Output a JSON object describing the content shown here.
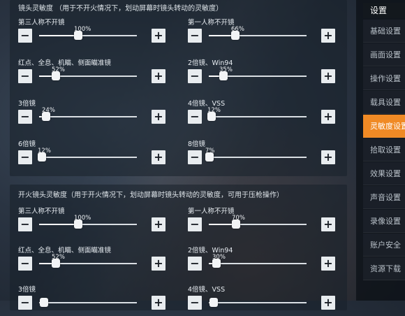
{
  "scope_section": {
    "title": "镜头灵敏度 （用于不开火情况下，划动屏幕时镜头转动的灵敏度）",
    "controls": [
      {
        "label": "第三人称不开镜",
        "value_text": "100%",
        "level": 0.4
      },
      {
        "label": "第一人称不开镜",
        "value_text": "66%",
        "level": 0.27
      },
      {
        "label": "红点、全息、机瞄、侧面瞄准镜",
        "value_text": "52%",
        "level": 0.17
      },
      {
        "label": "2倍镜、Win94",
        "value_text": "35%",
        "level": 0.15
      },
      {
        "label": "3倍镜",
        "value_text": "24%",
        "level": 0.07
      },
      {
        "label": "4倍镜、VSS",
        "value_text": "12%",
        "level": 0.03
      },
      {
        "label": "6倍镜",
        "value_text": "12%",
        "level": 0.03
      },
      {
        "label": "8倍镜",
        "value_text": "7%",
        "level": 0.01
      }
    ]
  },
  "fire_section": {
    "title": "开火镜头灵敏度（用于开火情况下，划动屏幕时镜头转动的灵敏度，可用于压枪操作）",
    "controls": [
      {
        "label": "第三人称不开镜",
        "value_text": "100%",
        "level": 0.4
      },
      {
        "label": "第一人称不开镜",
        "value_text": "70%",
        "level": 0.28
      },
      {
        "label": "红点、全息、机瞄、侧面瞄准镜",
        "value_text": "52%",
        "level": 0.17
      },
      {
        "label": "2倍镜、Win94",
        "value_text": "30%",
        "level": 0.08
      },
      {
        "label": "3倍镜",
        "value_text": "",
        "level": 0.05
      },
      {
        "label": "4倍镜、VSS",
        "value_text": "",
        "level": 0.05
      }
    ]
  },
  "buttons": {
    "minus": "−",
    "plus": "+"
  },
  "sidebar": {
    "title": "设置",
    "items": [
      {
        "label": "基础设置",
        "active": false
      },
      {
        "label": "画面设置",
        "active": false
      },
      {
        "label": "操作设置",
        "active": false
      },
      {
        "label": "载具设置",
        "active": false
      },
      {
        "label": "灵敏度设置",
        "active": true
      },
      {
        "label": "拾取设置",
        "active": false
      },
      {
        "label": "效果设置",
        "active": false
      },
      {
        "label": "声音设置",
        "active": false
      },
      {
        "label": "录像设置",
        "active": false
      },
      {
        "label": "账户安全",
        "active": false
      },
      {
        "label": "资源下载",
        "active": false
      }
    ]
  },
  "colors": {
    "accent": "#f08a25"
  }
}
